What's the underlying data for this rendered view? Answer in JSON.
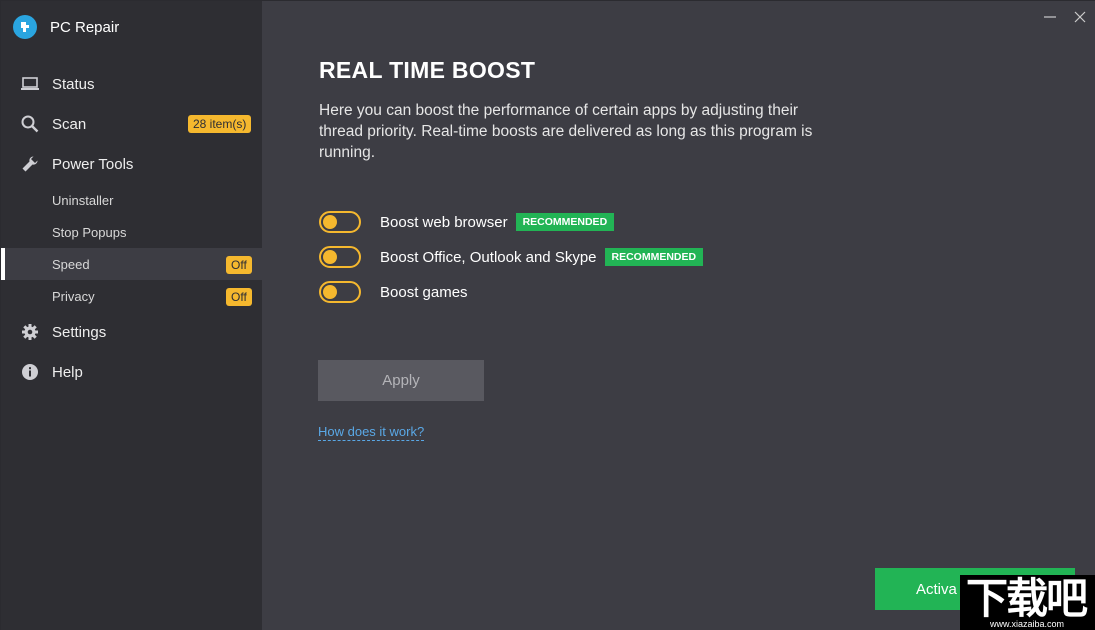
{
  "app": {
    "title": "PC Repair",
    "logo_icon": "wrench-shield-icon"
  },
  "sidebar": {
    "items": [
      {
        "label": "Status",
        "icon": "laptop-icon"
      },
      {
        "label": "Scan",
        "icon": "search-icon",
        "badge": "28 item(s)"
      },
      {
        "label": "Power Tools",
        "icon": "wrench-icon"
      },
      {
        "label": "Settings",
        "icon": "gear-icon"
      },
      {
        "label": "Help",
        "icon": "info-icon"
      }
    ],
    "sub_items": [
      {
        "label": "Uninstaller"
      },
      {
        "label": "Stop Popups"
      },
      {
        "label": "Speed",
        "badge": "Off",
        "active": true
      },
      {
        "label": "Privacy",
        "badge": "Off"
      }
    ]
  },
  "window": {
    "minimize_icon": "minimize-icon",
    "close_icon": "close-icon"
  },
  "main": {
    "title": "REAL TIME BOOST",
    "description": "Here you can boost the performance of certain apps by adjusting their thread priority. Real-time boosts are delivered as long as this program is running.",
    "options": [
      {
        "label": "Boost web browser",
        "badge": "RECOMMENDED",
        "enabled": true
      },
      {
        "label": "Boost Office, Outlook and Skype",
        "badge": "RECOMMENDED",
        "enabled": true
      },
      {
        "label": "Boost games",
        "enabled": true
      }
    ],
    "apply_label": "Apply",
    "how_link": "How does it work?",
    "activate_label": "Activa"
  },
  "watermark": {
    "main": "下载吧",
    "sub": "www.xiazaiba.com"
  },
  "colors": {
    "accent_yellow": "#f5b82e",
    "green": "#22b455",
    "sidebar_bg": "#2e2e33",
    "main_bg": "#3d3d44",
    "link": "#5aa8e6"
  }
}
